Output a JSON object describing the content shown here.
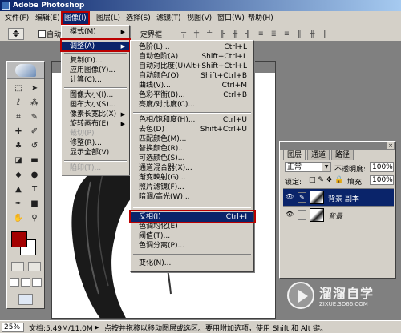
{
  "app": {
    "title": "Adobe Photoshop"
  },
  "menubar": [
    {
      "label": "文件(F)"
    },
    {
      "label": "编辑(E)"
    },
    {
      "label": "图像(I)"
    },
    {
      "label": "图层(L)"
    },
    {
      "label": "选择(S)"
    },
    {
      "label": "滤镜(T)"
    },
    {
      "label": "视图(V)"
    },
    {
      "label": "窗口(W)"
    },
    {
      "label": "帮助(H)"
    }
  ],
  "options": {
    "auto_select_label": "自动",
    "frame_label": "定界框"
  },
  "image_menu": [
    {
      "label": "模式(M)",
      "submenu": true
    },
    {
      "label": "调整(A)",
      "submenu": true
    },
    {
      "label": "复制(D)..."
    },
    {
      "label": "应用图像(Y)..."
    },
    {
      "label": "计算(C)..."
    },
    {
      "label": "图像大小(I)..."
    },
    {
      "label": "画布大小(S)..."
    },
    {
      "label": "像素长宽比(X)",
      "submenu": true
    },
    {
      "label": "旋转画布(E)",
      "submenu": true
    },
    {
      "label": "裁切(P)"
    },
    {
      "label": "修整(R)..."
    },
    {
      "label": "显示全部(V)"
    },
    {
      "label": "陷印(T)..."
    }
  ],
  "adjust_menu": [
    {
      "label": "色阶(L)...",
      "key": "Ctrl+L"
    },
    {
      "label": "自动色阶(A)",
      "key": "Shift+Ctrl+L"
    },
    {
      "label": "自动对比度(U)",
      "key": "Alt+Shift+Ctrl+L"
    },
    {
      "label": "自动颜色(O)",
      "key": "Shift+Ctrl+B"
    },
    {
      "label": "曲线(V)...",
      "key": "Ctrl+M"
    },
    {
      "label": "色彩平衡(B)...",
      "key": "Ctrl+B"
    },
    {
      "label": "亮度/对比度(C)...",
      "key": ""
    },
    {
      "label": "色相/饱和度(H)...",
      "key": "Ctrl+U"
    },
    {
      "label": "去色(D)",
      "key": "Shift+Ctrl+U"
    },
    {
      "label": "匹配颜色(M)...",
      "key": ""
    },
    {
      "label": "替换颜色(R)...",
      "key": ""
    },
    {
      "label": "可选颜色(S)...",
      "key": ""
    },
    {
      "label": "通道混合器(X)...",
      "key": ""
    },
    {
      "label": "渐变映射(G)...",
      "key": ""
    },
    {
      "label": "照片滤镜(F)...",
      "key": ""
    },
    {
      "label": "暗调/高光(W)...",
      "key": ""
    },
    {
      "label": "反相(I)",
      "key": "Ctrl+I"
    },
    {
      "label": "色调均化(E)",
      "key": ""
    },
    {
      "label": "阈值(T)...",
      "key": ""
    },
    {
      "label": "色调分离(P)...",
      "key": ""
    },
    {
      "label": "变化(N)...",
      "key": ""
    }
  ],
  "layers_panel": {
    "tabs": [
      "图层",
      "通道",
      "路径"
    ],
    "blend_mode": "正常",
    "opacity_label": "不透明度:",
    "opacity_value": "100%",
    "lock_label": "锁定:",
    "fill_label": "填充:",
    "fill_value": "100%",
    "layers": [
      {
        "name": "背景 副本",
        "selected": true
      },
      {
        "name": "背景",
        "selected": false
      }
    ]
  },
  "status": {
    "zoom": "25%",
    "doc_size": "文档:5.49M/11.0M",
    "hint": "点按并拖移以移动图层或选区。要用附加选项，使用 Shift 和 Alt 键。"
  },
  "watermark": {
    "title": "溜溜自学",
    "site": "ZIXUE.3D66.COM"
  },
  "colors": {
    "foreground": "#a30000",
    "background": "#ffffff",
    "highlight": "#0a246a",
    "annotation_box": "#bb0000"
  }
}
